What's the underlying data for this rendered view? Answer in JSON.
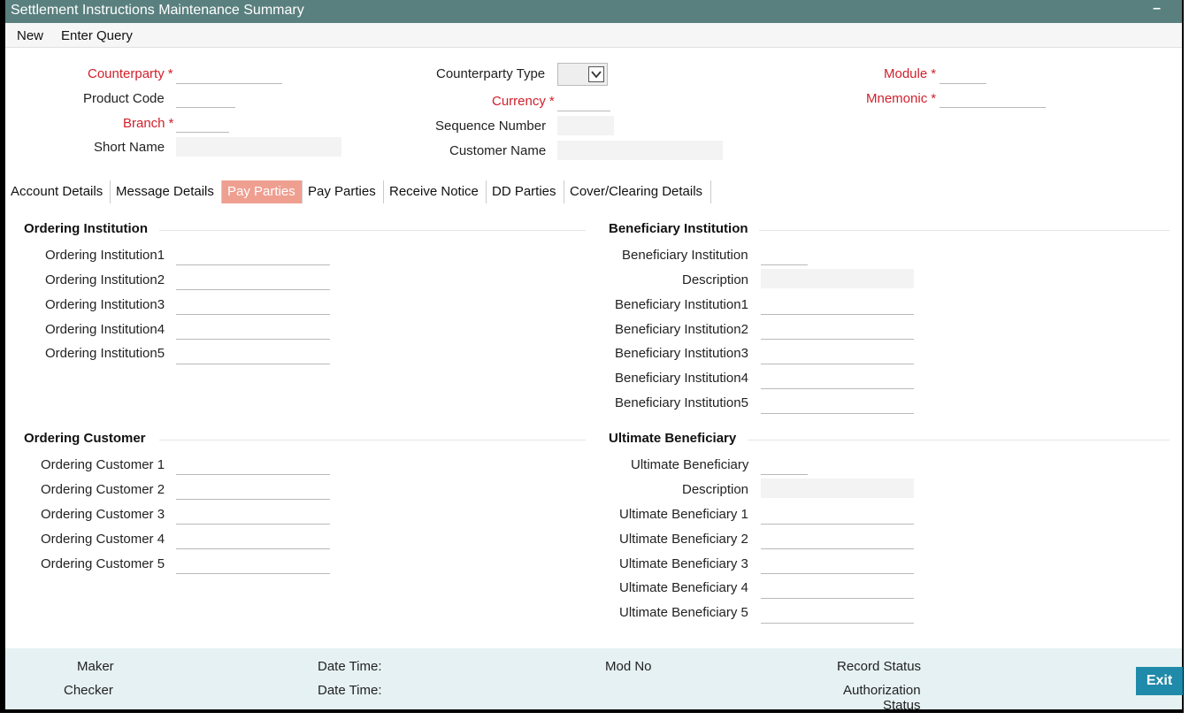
{
  "window": {
    "title": "Settlement Instructions Maintenance Summary"
  },
  "menu": {
    "new": "New",
    "enter_query": "Enter Query"
  },
  "header": {
    "counterparty": {
      "label": "Counterparty",
      "value": ""
    },
    "product_code": {
      "label": "Product Code",
      "value": ""
    },
    "branch": {
      "label": "Branch",
      "value": ""
    },
    "short_name": {
      "label": "Short Name",
      "value": ""
    },
    "counterparty_type": {
      "label": "Counterparty Type",
      "value": ""
    },
    "currency": {
      "label": "Currency",
      "value": ""
    },
    "sequence_number": {
      "label": "Sequence Number",
      "value": ""
    },
    "customer_name": {
      "label": "Customer Name",
      "value": ""
    },
    "module": {
      "label": "Module",
      "value": ""
    },
    "mnemonic": {
      "label": "Mnemonic",
      "value": ""
    },
    "required_mark": "*"
  },
  "tabs": [
    {
      "label": "Account Details"
    },
    {
      "label": "Message Details"
    },
    {
      "label": "Pay Parties"
    },
    {
      "label": "Pay Parties"
    },
    {
      "label": "Receive Notice"
    },
    {
      "label": "DD Parties"
    },
    {
      "label": "Cover/Clearing Details"
    }
  ],
  "ordering_institution": {
    "title": "Ordering Institution",
    "fields": [
      "Ordering Institution1",
      "Ordering Institution2",
      "Ordering Institution3",
      "Ordering Institution4",
      "Ordering Institution5"
    ]
  },
  "ordering_customer": {
    "title": "Ordering Customer",
    "fields": [
      "Ordering Customer 1",
      "Ordering Customer 2",
      "Ordering Customer 3",
      "Ordering Customer 4",
      "Ordering Customer 5"
    ]
  },
  "beneficiary_institution": {
    "title": "Beneficiary Institution",
    "code_label": "Beneficiary Institution",
    "description_label": "Description",
    "fields": [
      "Beneficiary Institution1",
      "Beneficiary Institution2",
      "Beneficiary Institution3",
      "Beneficiary Institution4",
      "Beneficiary Institution5"
    ]
  },
  "ultimate_beneficiary": {
    "title": "Ultimate Beneficiary",
    "code_label": "Ultimate Beneficiary",
    "description_label": "Description",
    "fields": [
      "Ultimate Beneficiary 1",
      "Ultimate Beneficiary 2",
      "Ultimate Beneficiary 3",
      "Ultimate Beneficiary 4",
      "Ultimate Beneficiary 5"
    ]
  },
  "footer": {
    "maker": "Maker",
    "checker": "Checker",
    "date_time_1": "Date Time:",
    "date_time_2": "Date Time:",
    "mod_no": "Mod No",
    "record_status": "Record Status",
    "authorization": "Authorization",
    "status": "Status",
    "exit": "Exit"
  },
  "colors": {
    "titlebar": "#59807f",
    "required": "#d0202c",
    "active_tab": "#ef9f90",
    "footer": "#e6f1f3",
    "exit_button": "#1f8aa9"
  }
}
